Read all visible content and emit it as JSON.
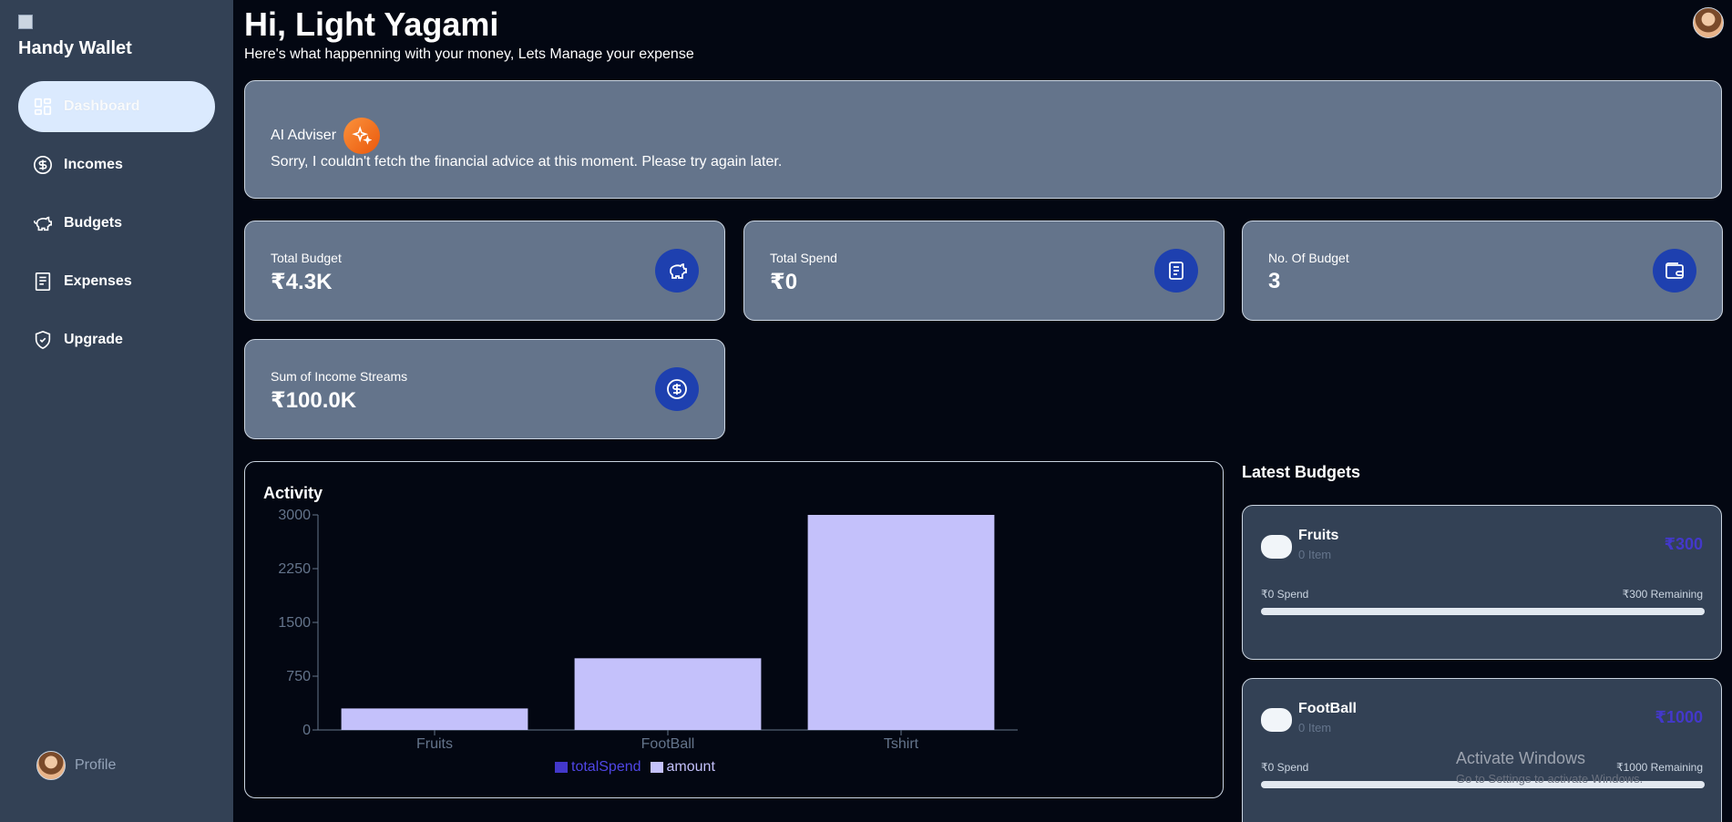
{
  "app": {
    "name": "Handy Wallet"
  },
  "sidebar": {
    "items": [
      {
        "label": "Dashboard",
        "icon": "grid-icon",
        "active": true
      },
      {
        "label": "Incomes",
        "icon": "dollar-circle-icon",
        "active": false
      },
      {
        "label": "Budgets",
        "icon": "piggy-bank-icon",
        "active": false
      },
      {
        "label": "Expenses",
        "icon": "receipt-icon",
        "active": false
      },
      {
        "label": "Upgrade",
        "icon": "shield-check-icon",
        "active": false
      }
    ],
    "profile_label": "Profile"
  },
  "header": {
    "greeting": "Hi, Light Yagami",
    "subtitle": "Here's what happenning with your money, Lets Manage your expense"
  },
  "advisor": {
    "title": "AI Adviser",
    "message": "Sorry, I couldn't fetch the financial advice at this moment. Please try again later."
  },
  "stats": [
    {
      "label": "Total Budget",
      "value": "₹4.3K",
      "icon": "piggy-bank-icon"
    },
    {
      "label": "Total Spend",
      "value": "₹0",
      "icon": "receipt-icon"
    },
    {
      "label": "No. Of Budget",
      "value": "3",
      "icon": "wallet-icon"
    },
    {
      "label": "Sum of Income Streams",
      "value": "₹100.0K",
      "icon": "dollar-circle-icon"
    }
  ],
  "activity": {
    "title": "Activity",
    "legend": [
      "totalSpend",
      "amount"
    ]
  },
  "chart_data": {
    "type": "bar",
    "title": "Activity",
    "categories": [
      "Fruits",
      "FootBall",
      "Tshirt"
    ],
    "series": [
      {
        "name": "totalSpend",
        "values": [
          0,
          0,
          0
        ],
        "color": "#4338ca"
      },
      {
        "name": "amount",
        "values": [
          300,
          1000,
          3000
        ],
        "color": "#c4c1fb"
      }
    ],
    "yticks": [
      "0",
      "750",
      "1500",
      "2250",
      "3000"
    ],
    "ylim": [
      0,
      3000
    ],
    "legend_position": "bottom",
    "grid": false
  },
  "latest_budgets": {
    "title": "Latest Budgets",
    "items": [
      {
        "name": "Fruits",
        "items": "0 Item",
        "amount": "₹300",
        "spend": "₹0 Spend",
        "remaining": "₹300 Remaining",
        "progress": 0
      },
      {
        "name": "FootBall",
        "items": "0 Item",
        "amount": "₹1000",
        "spend": "₹0 Spend",
        "remaining": "₹1000 Remaining",
        "progress": 0
      }
    ]
  },
  "watermark": {
    "line1": "Activate Windows",
    "line2": "Go to Settings to activate Windows."
  },
  "colors": {
    "background": "#030712",
    "sidebar": "#334155",
    "card": "#64748b",
    "accent": "#4338ca",
    "icon_circle": "#1e40af",
    "bar_amount": "#c4c1fb"
  }
}
